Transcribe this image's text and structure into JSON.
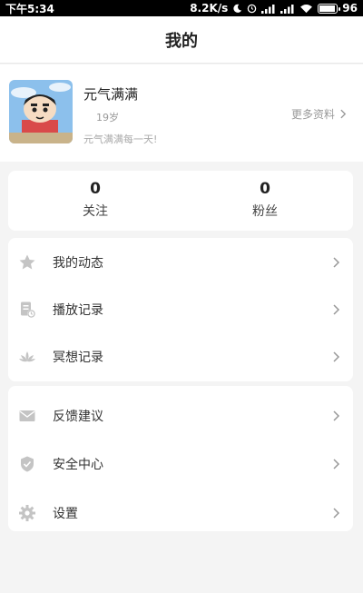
{
  "status_bar": {
    "time": "下午5:34",
    "speed": "8.2K/s",
    "battery_level": "96"
  },
  "header": {
    "title": "我的"
  },
  "profile": {
    "name": "元气满满",
    "age": "19岁",
    "bio": "元气满满每一天!",
    "more_label": "更多资料"
  },
  "stats": {
    "following": {
      "count": "0",
      "label": "关注"
    },
    "followers": {
      "count": "0",
      "label": "粉丝"
    }
  },
  "menu_group_1": [
    {
      "label": "我的动态",
      "icon": "star-icon"
    },
    {
      "label": "播放记录",
      "icon": "history-icon"
    },
    {
      "label": "冥想记录",
      "icon": "lotus-icon"
    }
  ],
  "menu_group_2": [
    {
      "label": "反馈建议",
      "icon": "mail-icon"
    },
    {
      "label": "安全中心",
      "icon": "shield-icon"
    },
    {
      "label": "设置",
      "icon": "gear-icon"
    }
  ],
  "colors": {
    "background": "#f4f4f4",
    "card": "#ffffff",
    "icon": "#c4c4c4",
    "text_primary": "#333333",
    "text_secondary": "#999999"
  }
}
